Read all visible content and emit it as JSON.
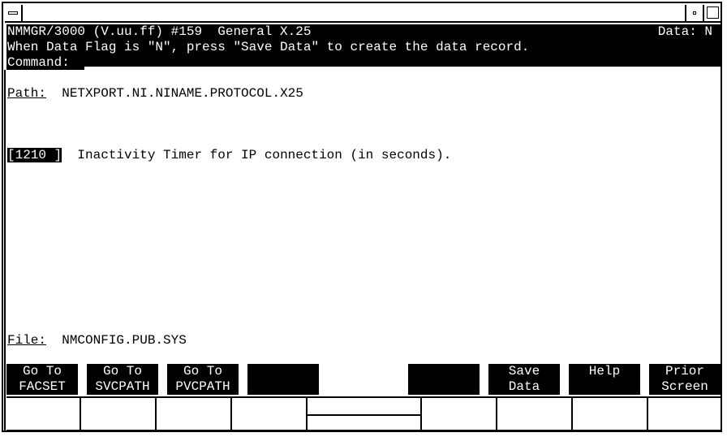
{
  "window": {
    "menu_icon": "window-menu-icon",
    "minimize_icon": "minimize-icon",
    "maximize_icon": "maximize-icon"
  },
  "header": {
    "title": "NMMGR/3000 (V.uu.ff) #159  General X.25",
    "data_flag": "Data: N",
    "message": "When Data Flag is \"N\", press \"Save Data\" to create the data record.",
    "command_label": "Command:",
    "command_value": ""
  },
  "path": {
    "label": "Path:",
    "value": "NETXPORT.NI.NINAME.PROTOCOL.X25"
  },
  "fields": [
    {
      "value": "[1210 ]",
      "description": "Inactivity Timer for IP connection (in seconds)."
    }
  ],
  "file": {
    "label": "File:",
    "value": "NMCONFIG.PUB.SYS"
  },
  "function_keys": [
    {
      "line1": "Go To",
      "line2": "FACSET"
    },
    {
      "line1": "Go To",
      "line2": "SVCPATH"
    },
    {
      "line1": "Go To",
      "line2": "PVCPATH"
    },
    {
      "line1": "",
      "line2": ""
    },
    {
      "line1": "",
      "line2": ""
    },
    {
      "line1": "Save",
      "line2": "Data"
    },
    {
      "line1": "Help",
      "line2": ""
    },
    {
      "line1": "Prior",
      "line2": "Screen"
    }
  ]
}
